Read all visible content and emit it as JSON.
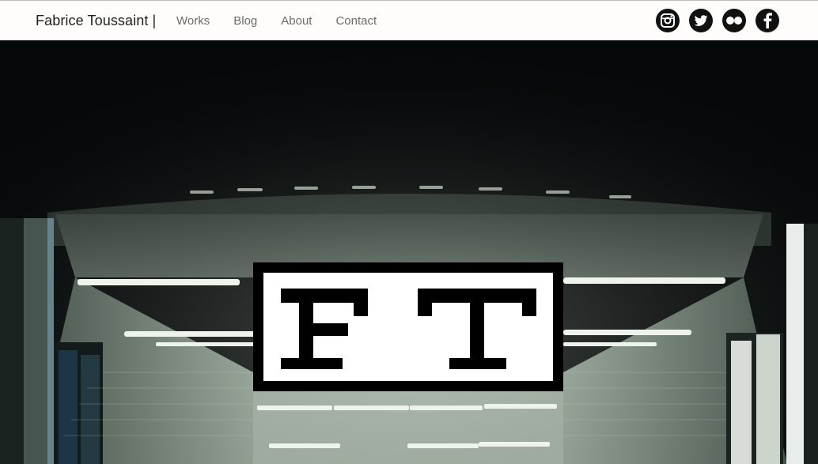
{
  "header": {
    "brand": "Fabrice Toussaint |",
    "nav": [
      {
        "label": "Works"
      },
      {
        "label": "Blog"
      },
      {
        "label": "About"
      },
      {
        "label": "Contact"
      }
    ],
    "social": [
      {
        "icon": "instagram-icon"
      },
      {
        "icon": "twitter-icon"
      },
      {
        "icon": "flickr-icon"
      },
      {
        "icon": "facebook-icon"
      }
    ]
  },
  "hero": {
    "logo_text": "FT",
    "image": "subway-tunnel-photo"
  },
  "colors": {
    "navbar_bg": "#fffdfb",
    "brand_text": "#1f1f1f",
    "nav_text": "#6c6c6c",
    "icon_bg": "#111111",
    "hero_bg": "#050707",
    "tunnel_tint": "#8a9a8c"
  }
}
